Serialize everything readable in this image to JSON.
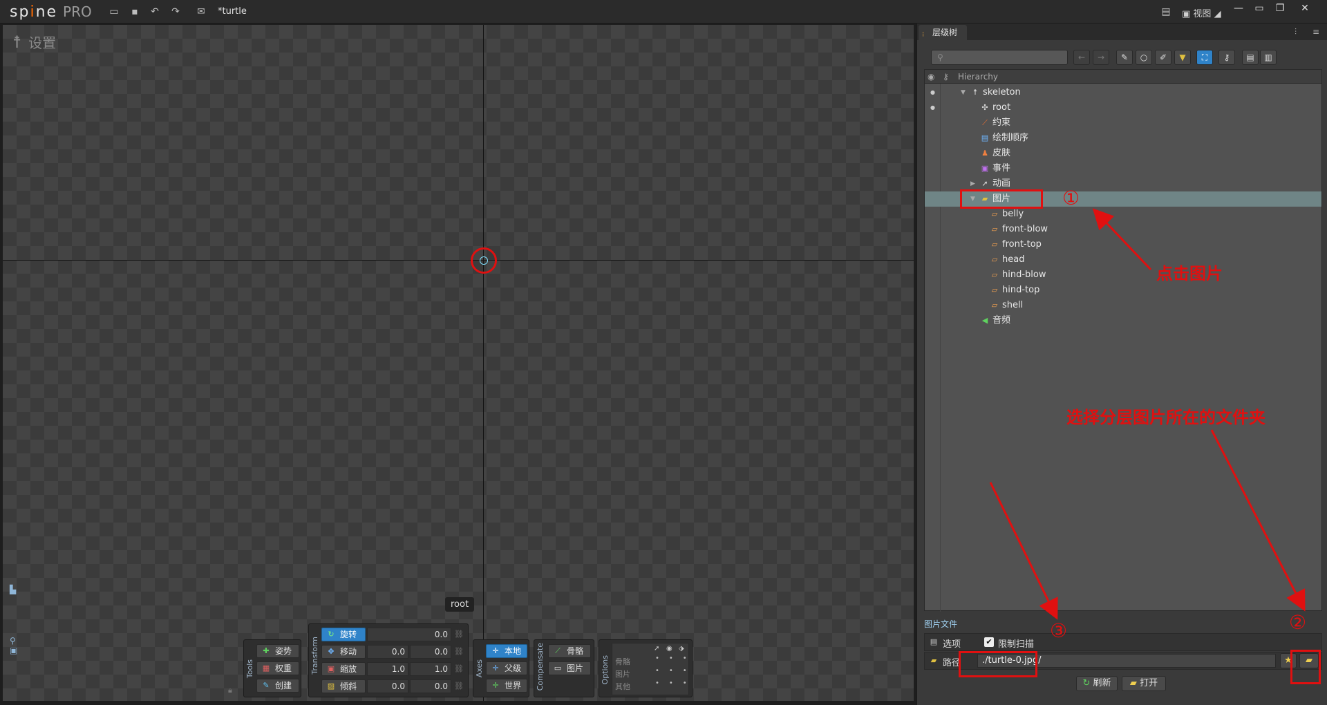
{
  "app": {
    "logo_a": "sp",
    "logo_dot": "i",
    "logo_b": "ne",
    "logo_pro": "PRO",
    "filename": "*turtle",
    "view_menu": "视图",
    "colors": {
      "accent": "#2f83c9",
      "annotation": "#e01010",
      "selected_row": "#6f8586"
    }
  },
  "viewport": {
    "settings_label": "设置",
    "root_label": "root"
  },
  "tools": {
    "title": "Tools",
    "pose": "姿势",
    "weights": "权重",
    "create": "创建"
  },
  "transform": {
    "title": "Transform",
    "rotate": {
      "label": "旋转",
      "value": "0.0"
    },
    "translate": {
      "label": "移动",
      "x": "0.0",
      "y": "0.0"
    },
    "scale": {
      "label": "缩放",
      "x": "1.0",
      "y": "1.0"
    },
    "shear": {
      "label": "倾斜",
      "x": "0.0",
      "y": "0.0"
    }
  },
  "axes": {
    "title": "Axes",
    "local": "本地",
    "parent": "父级",
    "world": "世界"
  },
  "compensate": {
    "title": "Compensate",
    "bones": "骨骼",
    "images": "图片"
  },
  "options": {
    "title": "Options",
    "bones": "骨骼",
    "images": "图片",
    "others": "其他"
  },
  "right_panel": {
    "tab_label": "层级树",
    "hierarchy_header": "Hierarchy",
    "tree": [
      {
        "label": "skeleton",
        "icon": "skeleton-icon",
        "level": 0,
        "arrow": "▼"
      },
      {
        "label": "root",
        "icon": "bone-icon",
        "level": 1
      },
      {
        "label": "约束",
        "icon": "constraint-icon",
        "level": 1
      },
      {
        "label": "绘制顺序",
        "icon": "draw-order-icon",
        "level": 1
      },
      {
        "label": "皮肤",
        "icon": "skin-icon",
        "level": 1
      },
      {
        "label": "事件",
        "icon": "event-icon",
        "level": 1
      },
      {
        "label": "动画",
        "icon": "animation-icon",
        "level": 1,
        "arrow": "▶"
      },
      {
        "label": "图片",
        "icon": "folder-icon",
        "level": 1,
        "arrow": "▼",
        "selected": true
      },
      {
        "label": "belly",
        "icon": "image-icon",
        "level": 2
      },
      {
        "label": "front-blow",
        "icon": "image-icon",
        "level": 2
      },
      {
        "label": "front-top",
        "icon": "image-icon",
        "level": 2
      },
      {
        "label": "head",
        "icon": "image-icon",
        "level": 2
      },
      {
        "label": "hind-blow",
        "icon": "image-icon",
        "level": 2
      },
      {
        "label": "hind-top",
        "icon": "image-icon",
        "level": 2
      },
      {
        "label": "shell",
        "icon": "image-icon",
        "level": 2
      },
      {
        "label": "音频",
        "icon": "audio-icon",
        "level": 1
      }
    ],
    "image_files_title": "图片文件",
    "options_label": "选项",
    "limit_scan_label": "限制扫描",
    "limit_scan_checked": true,
    "path_label": "路径",
    "path_value": "./turtle-0.jpg/",
    "refresh_label": "刷新",
    "open_label": "打开"
  },
  "annotations": {
    "num1": "①",
    "num2": "②",
    "num3": "③",
    "click_images": "点击图片",
    "choose_folder": "选择分层图片所在的文件夹"
  }
}
